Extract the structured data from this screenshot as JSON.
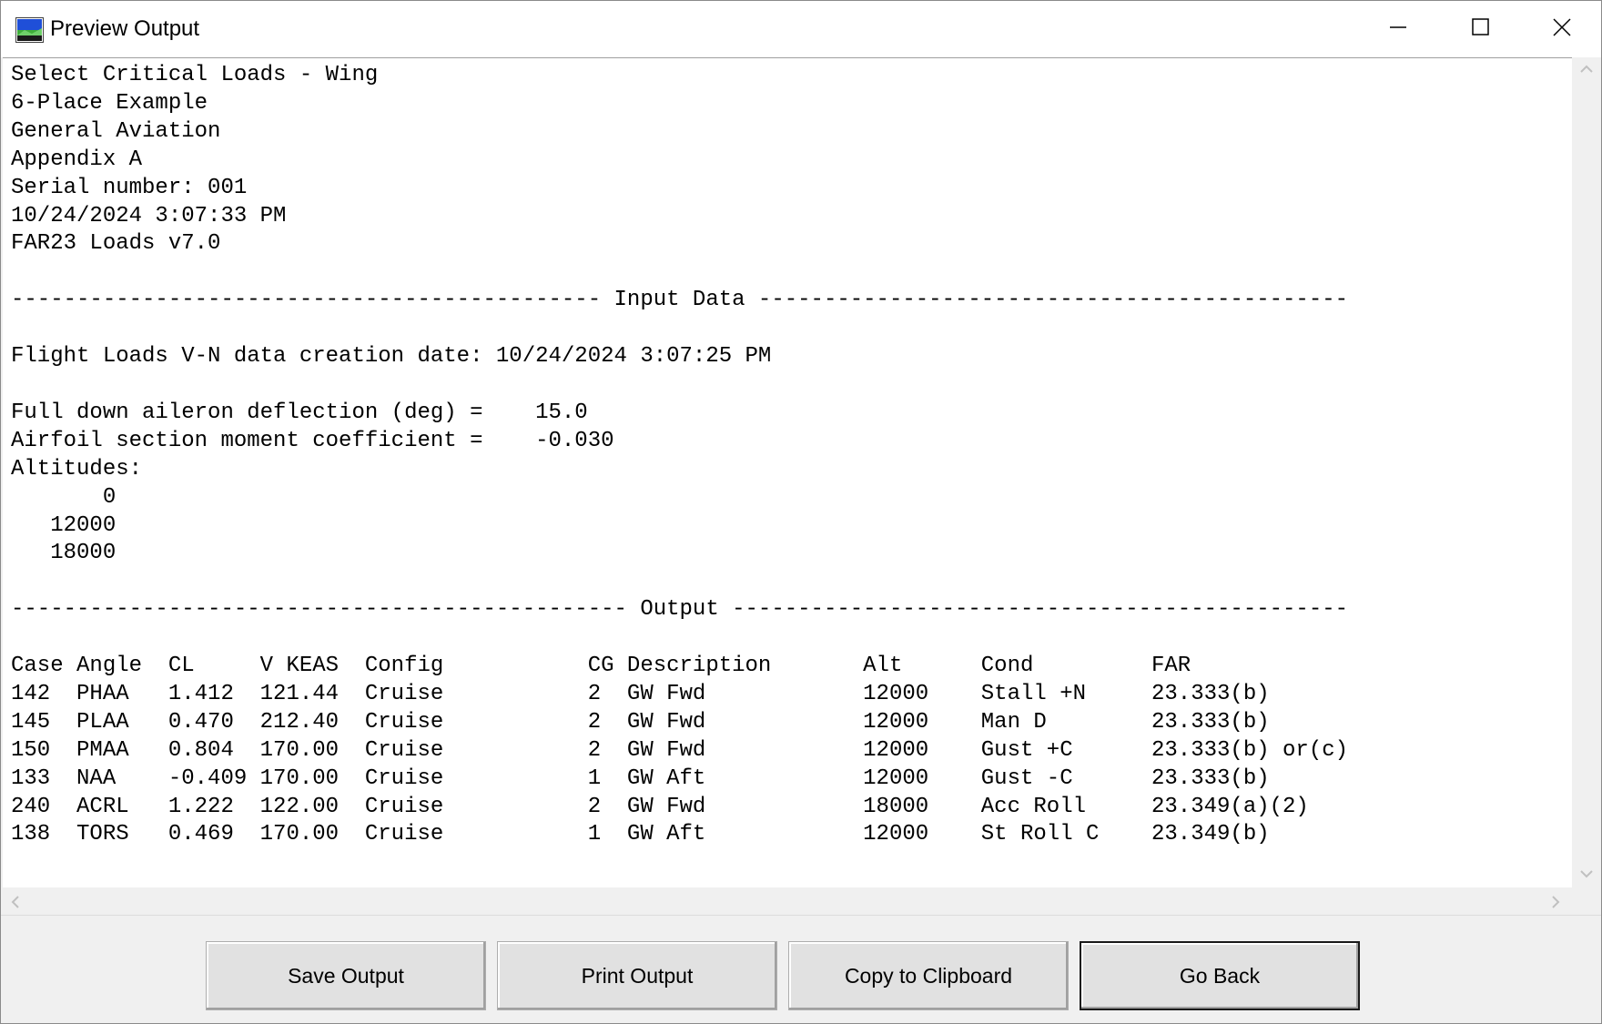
{
  "window": {
    "title": "Preview Output",
    "icon": "app-window-icon"
  },
  "output_lines": [
    "Select Critical Loads - Wing",
    "6-Place Example",
    "General Aviation",
    "Appendix A",
    "Serial number: 001",
    "10/24/2024 3:07:33 PM",
    "FAR23 Loads v7.0",
    "",
    "--------------------------------------------- Input Data ---------------------------------------------",
    "",
    "Flight Loads V-N data creation date: 10/24/2024 3:07:25 PM",
    "",
    "Full down aileron deflection (deg) =    15.0",
    "Airfoil section moment coefficient =    -0.030",
    "Altitudes:",
    "       0",
    "   12000",
    "   18000",
    "",
    "----------------------------------------------- Output -----------------------------------------------",
    "",
    "Case Angle  CL     V KEAS  Config           CG Description       Alt      Cond         FAR",
    "142  PHAA   1.412  121.44  Cruise           2  GW Fwd            12000    Stall +N     23.333(b)",
    "145  PLAA   0.470  212.40  Cruise           2  GW Fwd            12000    Man D        23.333(b)",
    "150  PMAA   0.804  170.00  Cruise           2  GW Fwd            12000    Gust +C      23.333(b) or(c)",
    "133  NAA    -0.409 170.00  Cruise           1  GW Aft            12000    Gust -C      23.333(b)",
    "240  ACRL   1.222  122.00  Cruise           2  GW Fwd            18000    Acc Roll     23.349(a)(2)",
    "138  TORS   0.469  170.00  Cruise           1  GW Aft            12000    St Roll C    23.349(b)"
  ],
  "buttons": {
    "save": "Save Output",
    "print": "Print Output",
    "copy": "Copy to Clipboard",
    "back": "Go Back"
  },
  "colors": {
    "window_bg": "#f0f0f0",
    "text_bg": "#ffffff",
    "button_bg": "#e1e1e1"
  }
}
